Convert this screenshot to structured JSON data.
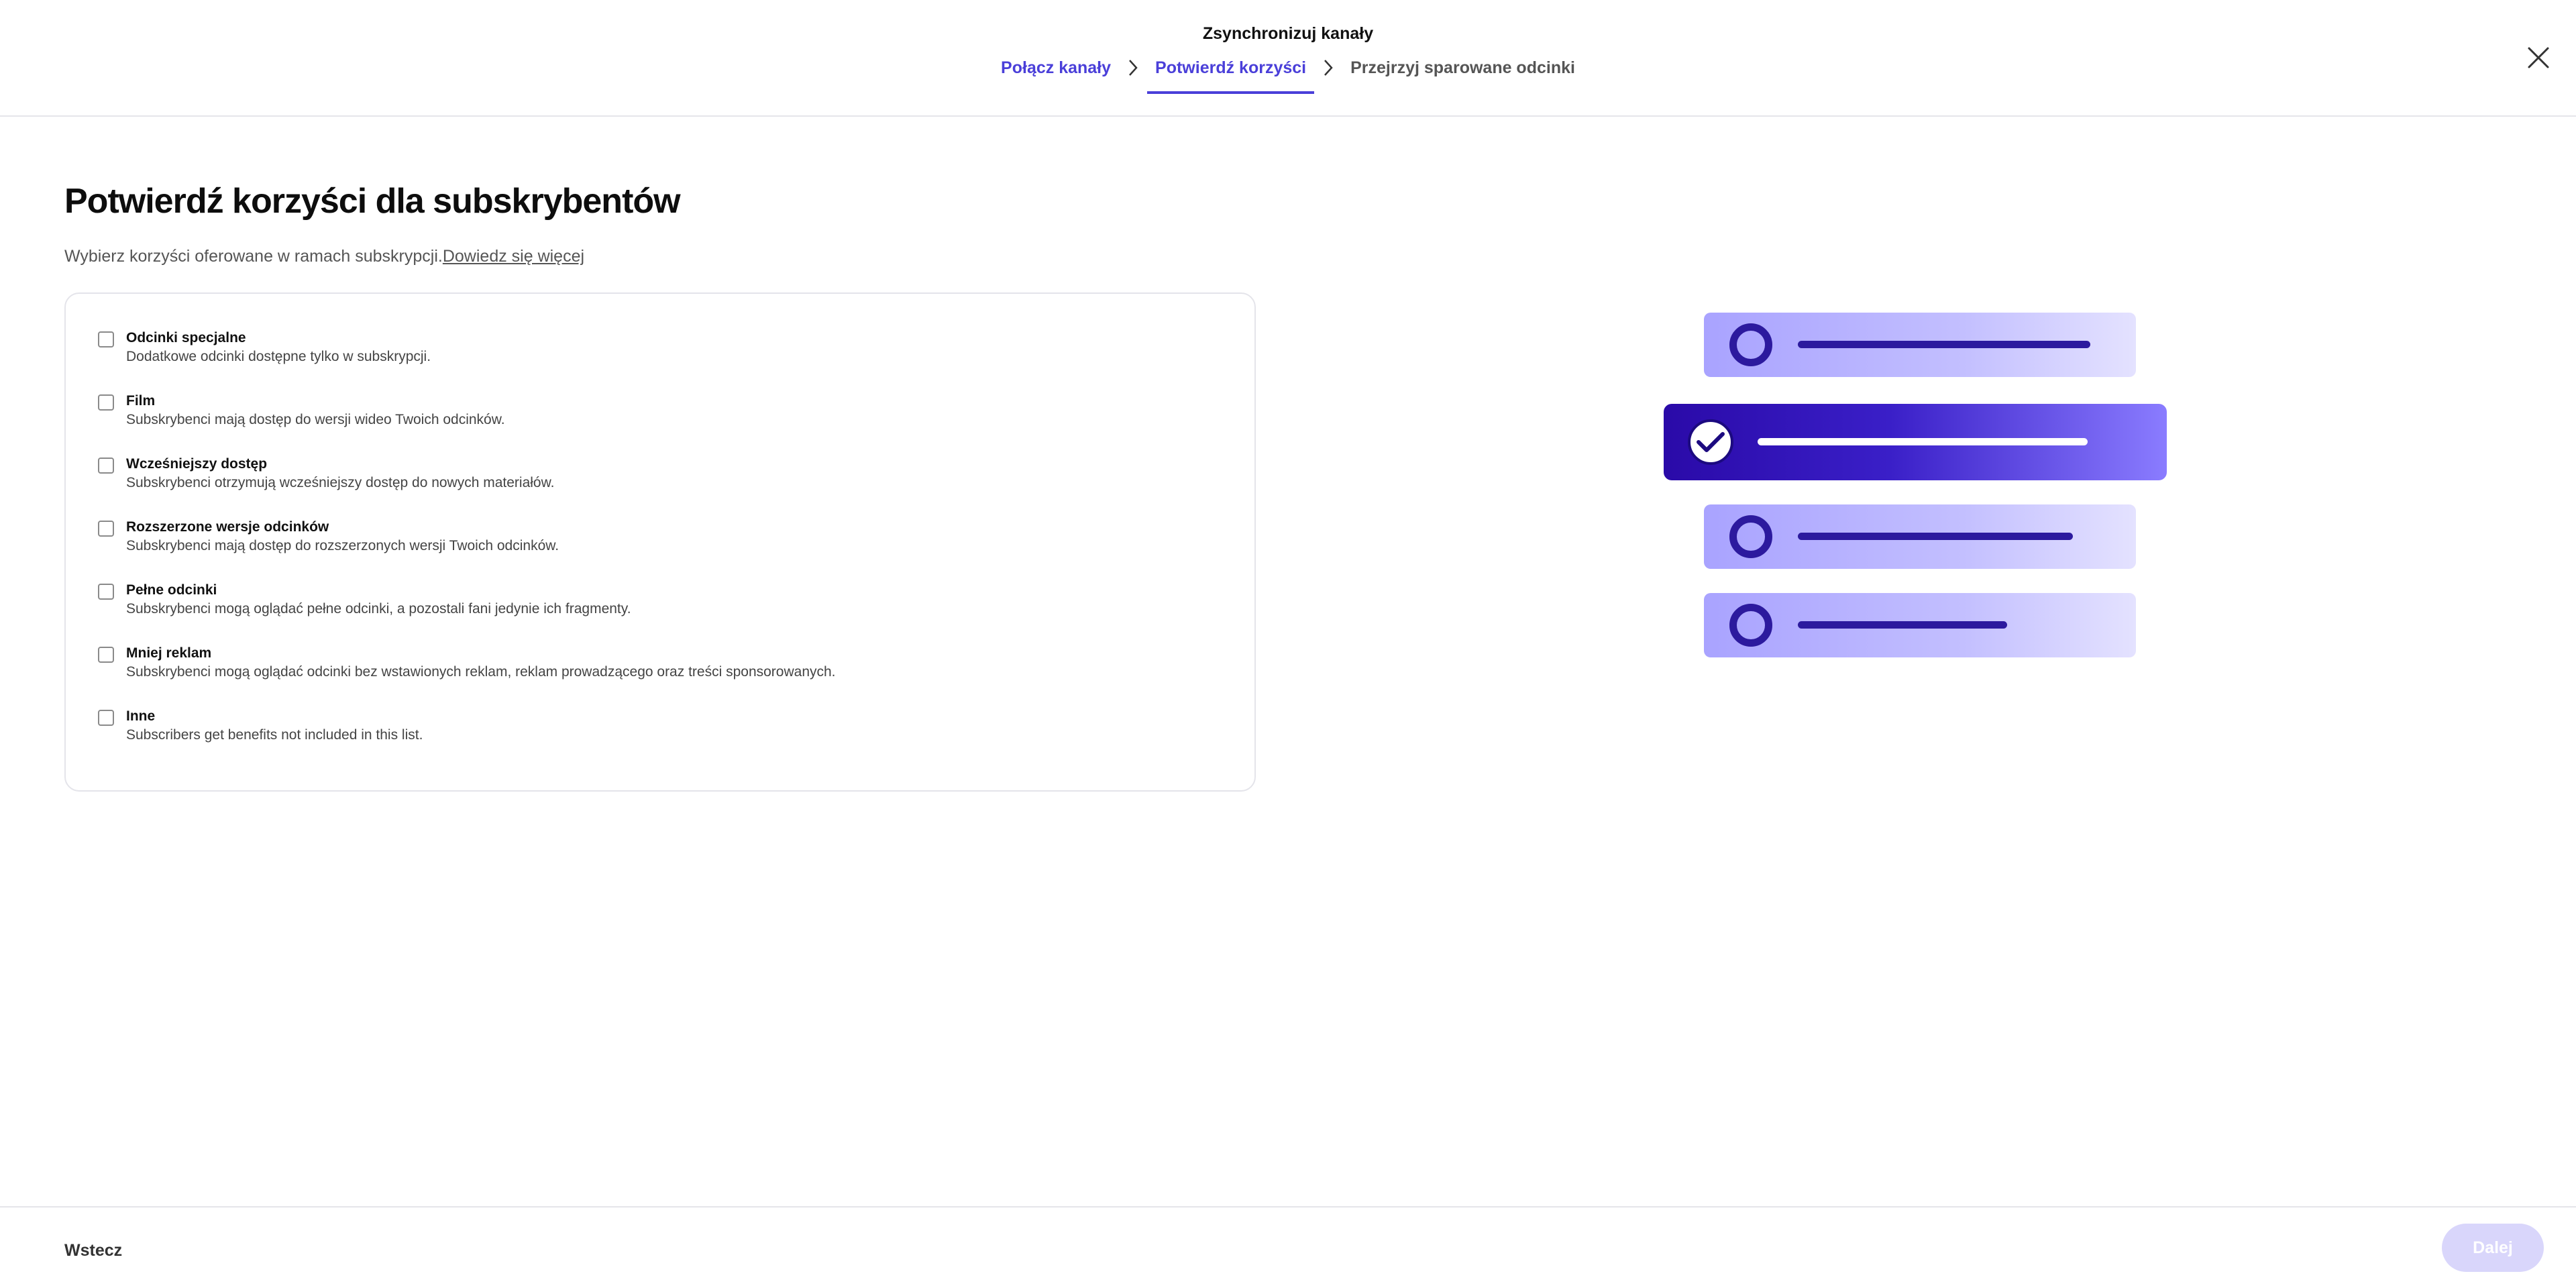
{
  "header": {
    "title": "Zsynchronizuj kanały",
    "steps": [
      {
        "label": "Połącz kanały",
        "state": "done"
      },
      {
        "label": "Potwierdź korzyści",
        "state": "current"
      },
      {
        "label": "Przejrzyj sparowane odcinki",
        "state": "upcoming"
      }
    ],
    "close_icon": "close-icon"
  },
  "main": {
    "title": "Potwierdź korzyści dla subskrybentów",
    "subtitle": "Wybierz korzyści oferowane w ramach subskrypcji.",
    "learn_more": "Dowiedz się więcej",
    "benefits": [
      {
        "name": "Odcinki specjalne",
        "description": "Dodatkowe odcinki dostępne tylko w subskrypcji.",
        "checked": false
      },
      {
        "name": "Film",
        "description": "Subskrybenci mają dostęp do wersji wideo Twoich odcinków.",
        "checked": false
      },
      {
        "name": "Wcześniejszy dostęp",
        "description": "Subskrybenci otrzymują wcześniejszy dostęp do nowych materiałów.",
        "checked": false
      },
      {
        "name": "Rozszerzone wersje odcinków",
        "description": "Subskrybenci mają dostęp do rozszerzonych wersji Twoich odcinków.",
        "checked": false
      },
      {
        "name": "Pełne odcinki",
        "description": "Subskrybenci mogą oglądać pełne odcinki, a pozostali fani jedynie ich fragmenty.",
        "checked": false
      },
      {
        "name": "Mniej reklam",
        "description": "Subskrybenci mogą oglądać odcinki bez wstawionych reklam, reklam prowadzącego oraz treści sponsorowanych.",
        "checked": false
      },
      {
        "name": "Inne",
        "description": "Subscribers get benefits not included in this list.",
        "checked": false
      }
    ]
  },
  "footer": {
    "back_label": "Wstecz",
    "next_label": "Dalej",
    "next_disabled": true
  },
  "colors": {
    "accent": "#4a3fd9",
    "illustration_dark": "#2c1a9e",
    "illustration_light": "#b9b4ff",
    "next_disabled_bg": "#d9d6fb"
  }
}
